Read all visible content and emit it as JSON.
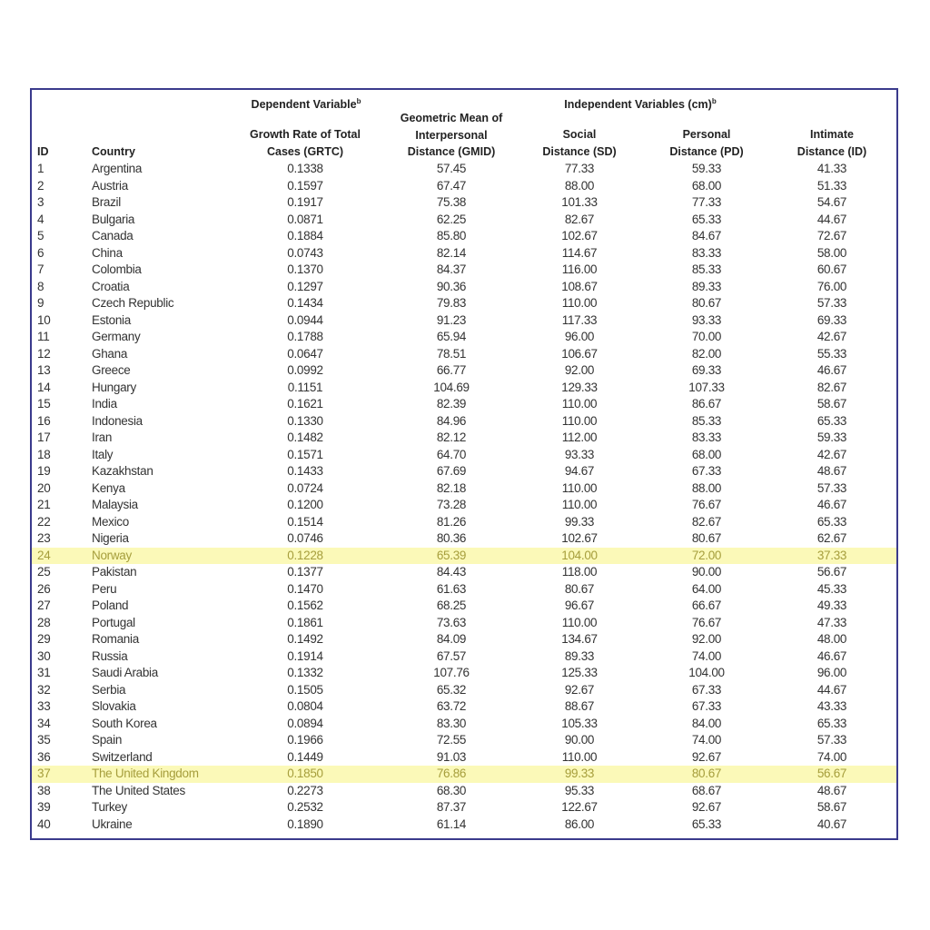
{
  "header": {
    "dependent_group": "Dependent Variable",
    "dependent_sup": "b",
    "independent_group": "Independent Variables (cm)",
    "independent_sup": "b",
    "columns": {
      "id": "ID",
      "country": "Country",
      "grtc": [
        "Growth Rate of Total",
        "Cases (GRTC)"
      ],
      "gmid": [
        "Geometric Mean of",
        "Interpersonal",
        "Distance (GMID)"
      ],
      "sd": [
        "Social",
        "Distance (SD)"
      ],
      "pd": [
        "Personal",
        "Distance (PD)"
      ],
      "intimate": [
        "Intimate",
        "Distance (ID)"
      ]
    }
  },
  "highlight_color": "#fbf9b8",
  "highlight_text_color": "#a69e3c",
  "border_color": "#3a3a8c",
  "rows": [
    [
      "1",
      "Argentina",
      "0.1338",
      "57.45",
      "77.33",
      "59.33",
      "41.33"
    ],
    [
      "2",
      "Austria",
      "0.1597",
      "67.47",
      "88.00",
      "68.00",
      "51.33"
    ],
    [
      "3",
      "Brazil",
      "0.1917",
      "75.38",
      "101.33",
      "77.33",
      "54.67"
    ],
    [
      "4",
      "Bulgaria",
      "0.0871",
      "62.25",
      "82.67",
      "65.33",
      "44.67"
    ],
    [
      "5",
      "Canada",
      "0.1884",
      "85.80",
      "102.67",
      "84.67",
      "72.67"
    ],
    [
      "6",
      "China",
      "0.0743",
      "82.14",
      "114.67",
      "83.33",
      "58.00"
    ],
    [
      "7",
      "Colombia",
      "0.1370",
      "84.37",
      "116.00",
      "85.33",
      "60.67"
    ],
    [
      "8",
      "Croatia",
      "0.1297",
      "90.36",
      "108.67",
      "89.33",
      "76.00"
    ],
    [
      "9",
      "Czech Republic",
      "0.1434",
      "79.83",
      "110.00",
      "80.67",
      "57.33"
    ],
    [
      "10",
      "Estonia",
      "0.0944",
      "91.23",
      "117.33",
      "93.33",
      "69.33"
    ],
    [
      "11",
      "Germany",
      "0.1788",
      "65.94",
      "96.00",
      "70.00",
      "42.67"
    ],
    [
      "12",
      "Ghana",
      "0.0647",
      "78.51",
      "106.67",
      "82.00",
      "55.33"
    ],
    [
      "13",
      "Greece",
      "0.0992",
      "66.77",
      "92.00",
      "69.33",
      "46.67"
    ],
    [
      "14",
      "Hungary",
      "0.1151",
      "104.69",
      "129.33",
      "107.33",
      "82.67"
    ],
    [
      "15",
      "India",
      "0.1621",
      "82.39",
      "110.00",
      "86.67",
      "58.67"
    ],
    [
      "16",
      "Indonesia",
      "0.1330",
      "84.96",
      "110.00",
      "85.33",
      "65.33"
    ],
    [
      "17",
      "Iran",
      "0.1482",
      "82.12",
      "112.00",
      "83.33",
      "59.33"
    ],
    [
      "18",
      "Italy",
      "0.1571",
      "64.70",
      "93.33",
      "68.00",
      "42.67"
    ],
    [
      "19",
      "Kazakhstan",
      "0.1433",
      "67.69",
      "94.67",
      "67.33",
      "48.67"
    ],
    [
      "20",
      "Kenya",
      "0.0724",
      "82.18",
      "110.00",
      "88.00",
      "57.33"
    ],
    [
      "21",
      "Malaysia",
      "0.1200",
      "73.28",
      "110.00",
      "76.67",
      "46.67"
    ],
    [
      "22",
      "Mexico",
      "0.1514",
      "81.26",
      "99.33",
      "82.67",
      "65.33"
    ],
    [
      "23",
      "Nigeria",
      "0.0746",
      "80.36",
      "102.67",
      "80.67",
      "62.67"
    ],
    [
      "24",
      "Norway",
      "0.1228",
      "65.39",
      "104.00",
      "72.00",
      "37.33"
    ],
    [
      "25",
      "Pakistan",
      "0.1377",
      "84.43",
      "118.00",
      "90.00",
      "56.67"
    ],
    [
      "26",
      "Peru",
      "0.1470",
      "61.63",
      "80.67",
      "64.00",
      "45.33"
    ],
    [
      "27",
      "Poland",
      "0.1562",
      "68.25",
      "96.67",
      "66.67",
      "49.33"
    ],
    [
      "28",
      "Portugal",
      "0.1861",
      "73.63",
      "110.00",
      "76.67",
      "47.33"
    ],
    [
      "29",
      "Romania",
      "0.1492",
      "84.09",
      "134.67",
      "92.00",
      "48.00"
    ],
    [
      "30",
      "Russia",
      "0.1914",
      "67.57",
      "89.33",
      "74.00",
      "46.67"
    ],
    [
      "31",
      "Saudi Arabia",
      "0.1332",
      "107.76",
      "125.33",
      "104.00",
      "96.00"
    ],
    [
      "32",
      "Serbia",
      "0.1505",
      "65.32",
      "92.67",
      "67.33",
      "44.67"
    ],
    [
      "33",
      "Slovakia",
      "0.0804",
      "63.72",
      "88.67",
      "67.33",
      "43.33"
    ],
    [
      "34",
      "South Korea",
      "0.0894",
      "83.30",
      "105.33",
      "84.00",
      "65.33"
    ],
    [
      "35",
      "Spain",
      "0.1966",
      "72.55",
      "90.00",
      "74.00",
      "57.33"
    ],
    [
      "36",
      "Switzerland",
      "0.1449",
      "91.03",
      "110.00",
      "92.67",
      "74.00"
    ],
    [
      "37",
      "The United Kingdom",
      "0.1850",
      "76.86",
      "99.33",
      "80.67",
      "56.67"
    ],
    [
      "38",
      "The United States",
      "0.2273",
      "68.30",
      "95.33",
      "68.67",
      "48.67"
    ],
    [
      "39",
      "Turkey",
      "0.2532",
      "87.37",
      "122.67",
      "92.67",
      "58.67"
    ],
    [
      "40",
      "Ukraine",
      "0.1890",
      "61.14",
      "86.00",
      "65.33",
      "40.67"
    ]
  ],
  "highlighted_ids": [
    "24",
    "37"
  ]
}
